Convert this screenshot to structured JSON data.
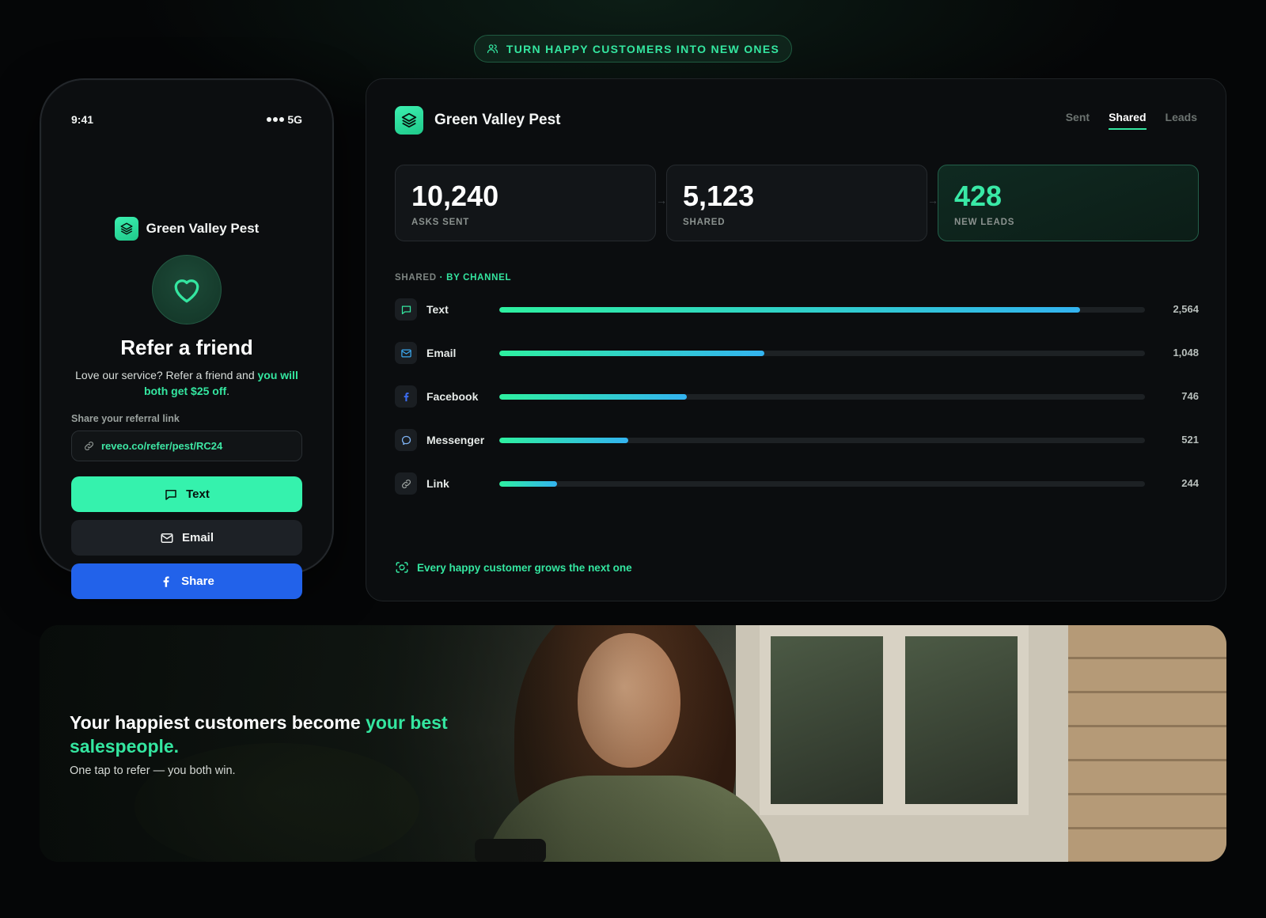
{
  "top_pill": {
    "label": "TURN HAPPY CUSTOMERS INTO NEW ONES"
  },
  "phone": {
    "time": "9:41",
    "network": "5G",
    "brand": "Green Valley Pest",
    "title": "Refer a friend",
    "desc_plain": "Love our service? Refer a friend and ",
    "desc_highlight": "you will both get $25 off",
    "desc_end": ".",
    "link_label": "Share your referral link",
    "link_value": "reveo.co/refer/pest/RC24",
    "buttons": {
      "text": "Text",
      "email": "Email",
      "share": "Share"
    }
  },
  "dashboard": {
    "brand": "Green Valley Pest",
    "tabs": [
      {
        "label": "Sent"
      },
      {
        "label": "Shared"
      },
      {
        "label": "Leads"
      }
    ],
    "active_tab": "Shared",
    "stats": [
      {
        "value": "10,240",
        "label": "ASKS SENT"
      },
      {
        "value": "5,123",
        "label": "SHARED"
      },
      {
        "value": "428",
        "label": "NEW LEADS"
      }
    ],
    "section_label": "SHARED",
    "section_highlight": "· BY CHANNEL",
    "channels": [
      {
        "name": "Text",
        "value": "2,564",
        "fraction": 0.9,
        "icon": "chat-icon"
      },
      {
        "name": "Email",
        "value": "1,048",
        "fraction": 0.41,
        "icon": "mail-icon"
      },
      {
        "name": "Facebook",
        "value": "746",
        "fraction": 0.29,
        "icon": "facebook-icon"
      },
      {
        "name": "Messenger",
        "value": "521",
        "fraction": 0.2,
        "icon": "messenger-icon"
      },
      {
        "name": "Link",
        "value": "244",
        "fraction": 0.09,
        "icon": "link-icon"
      }
    ],
    "footnote": "Every happy customer grows the next one"
  },
  "banner": {
    "title_plain": "Your happiest customers become ",
    "title_highlight": "your best salespeople.",
    "subtitle": "One tap to refer — you both win."
  },
  "colors": {
    "accent": "#34e6a0",
    "share_blue": "#2262ea",
    "background": "#050607"
  }
}
